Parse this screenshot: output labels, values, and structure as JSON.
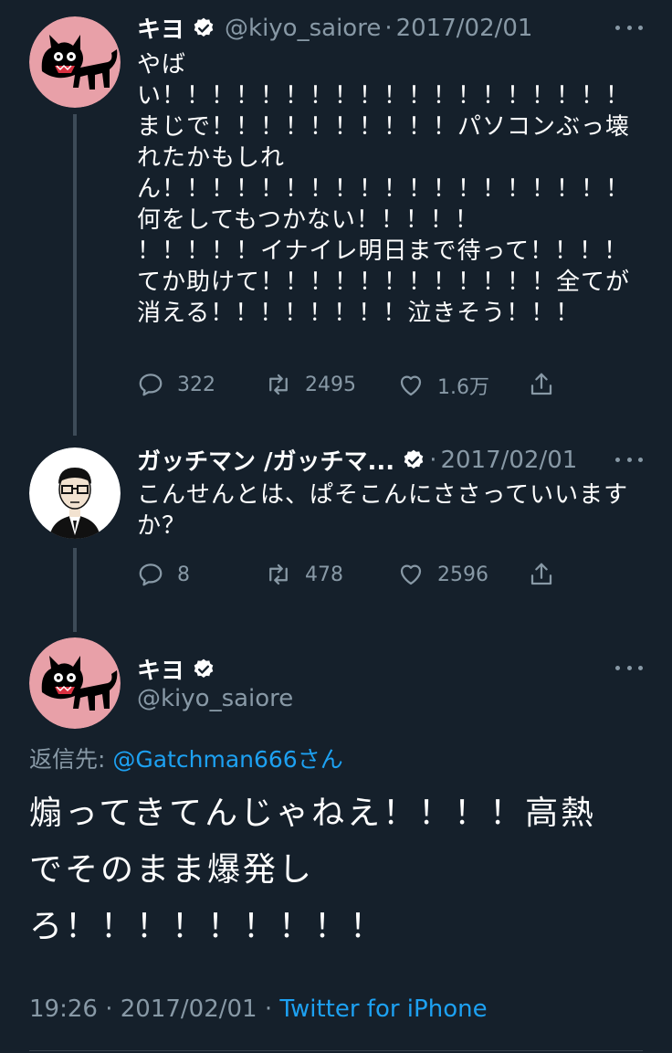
{
  "tweet1": {
    "name": "キヨ",
    "handle": "@kiyo_saiore",
    "dot": "·",
    "date": "2017/02/01",
    "lines": [
      "やば",
      "い！！！！！！！！！！！！！！！！！！！",
      "まじで！！！！！！！！！！パソコンぶっ壊",
      "れたかもしれ",
      "ん！！！！！！！！！！！！！！！！！！！",
      "何をしてもつかない！！！！！",
      "！！！！！イナイレ明日まで待って！！！！",
      "てか助けて！！！！！！！！！！！！全てが",
      "消える！！！！！！！！泣きそう！！！"
    ],
    "replies": "322",
    "retweets": "2495",
    "likes": "1.6万"
  },
  "tweet2": {
    "name": "ガッチマン /ガッチマ...",
    "dot": "·",
    "date": "2017/02/01",
    "lines": [
      "こんせんとは、ぱそこんにささっていいます",
      "か？"
    ],
    "replies": "8",
    "retweets": "478",
    "likes": "2596"
  },
  "main_tweet": {
    "name": "キヨ",
    "handle": "@kiyo_saiore",
    "reply_prefix": "返信先:",
    "reply_mention": "@Gatchman666",
    "reply_suffix": "さん",
    "lines": [
      "煽ってきてんじゃねえ！！！！高熱",
      "でそのまま爆発し",
      "ろ！！！！！！！！！"
    ],
    "time": "19:26",
    "dot": "·",
    "date": "2017/02/01",
    "dot2": "·",
    "source": "Twitter for iPhone"
  },
  "colors": {
    "background": "#15202b",
    "secondary_text": "#8899a6",
    "link": "#1da1f2",
    "avatar_pink": "#e8a0a8"
  },
  "icons": [
    "cat-avatar",
    "man-avatar",
    "verified-badge-icon",
    "reply-icon",
    "retweet-icon",
    "like-icon",
    "share-icon",
    "more-icon"
  ]
}
